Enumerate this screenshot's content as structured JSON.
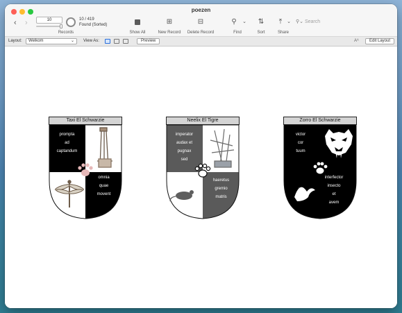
{
  "window": {
    "title": "poezen"
  },
  "toolbar": {
    "record_value": "10",
    "found_count": "10 / 419",
    "found_status": "Found (Sorted)",
    "records_label": "Records",
    "show_all_label": "Show All",
    "new_record_label": "New Record",
    "delete_record_label": "Delete Record",
    "find_label": "Find",
    "sort_label": "Sort",
    "share_label": "Share",
    "search_placeholder": "Search"
  },
  "layoutbar": {
    "layout_label": "Layout:",
    "layout_value": "Welkom",
    "view_as_label": "View As:",
    "preview_label": "Preview",
    "edit_layout_label": "Edit Layout",
    "text_size_label": "Aᴬ"
  },
  "cards": [
    {
      "name": "Taxi El Schwarzie",
      "motto_tl": [
        "prompta",
        "ad",
        "captandum"
      ],
      "motto_br": [
        "omnia",
        "quae",
        "movent"
      ]
    },
    {
      "name": "Neelix El Tigre",
      "motto_tl": [
        "imperator",
        "audax et",
        "pugnax",
        "sed"
      ],
      "motto_br": [
        "haeretus",
        "gremio",
        "matris"
      ]
    },
    {
      "name": "Zorro El Schwarzie",
      "motto_tl": [
        "victor",
        "cor",
        "tuum"
      ],
      "motto_br": [
        "interfector",
        "insecto",
        "et",
        "avem"
      ]
    }
  ],
  "icons": {
    "back": "chevron-left-icon",
    "forward": "chevron-right-icon",
    "show_all": "show-all-icon",
    "new_record": "plus-icon",
    "delete_record": "minus-icon",
    "find": "magnifier-icon",
    "sort": "sort-icon",
    "share": "share-icon"
  },
  "colors": {
    "shield_black": "#000000",
    "shield_gray": "#5a5a5a",
    "title_gray": "#d4d4d4",
    "accent": "#2a6fdb"
  }
}
